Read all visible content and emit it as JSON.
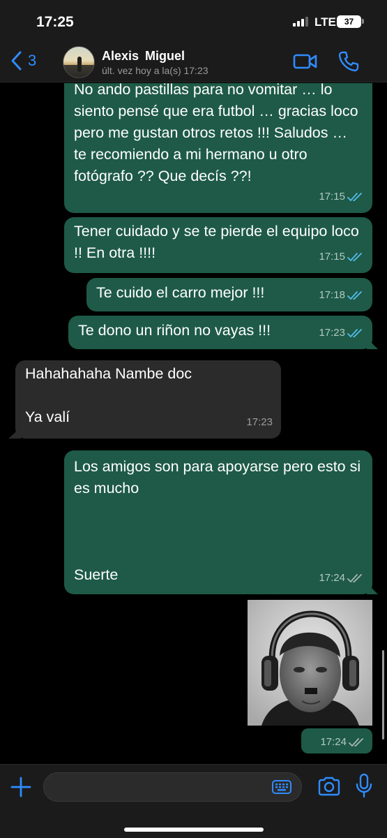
{
  "status_bar": {
    "time": "17:25",
    "network": "LTE",
    "battery": "37"
  },
  "header": {
    "back_count": "3",
    "contact_name": "Alexis  Miguel",
    "last_seen": "últ. vez hoy a la(s) 17:23"
  },
  "messages": [
    {
      "direction": "outgoing",
      "text": "No ando pastillas para no vomitar … lo siento pensé que era futbol … gracias loco pero me gustan otros retos !!! Saludos … te recomiendo a mi hermano u otro fotógrafo ?? Que decís ??!",
      "time": "17:15",
      "status": "read"
    },
    {
      "direction": "outgoing",
      "text": "Tener cuidado y se te pierde el equipo loco !! En otra !!!!",
      "time": "17:15",
      "status": "read"
    },
    {
      "direction": "outgoing",
      "text": "Te cuido el carro mejor !!!",
      "time": "17:18",
      "status": "read"
    },
    {
      "direction": "outgoing",
      "text": "Te dono un riñon no vayas !!!",
      "time": "17:23",
      "status": "read"
    },
    {
      "direction": "incoming",
      "text": "Hahahahaha Nambe doc\n\nYa valí",
      "time": "17:23"
    },
    {
      "direction": "outgoing",
      "text": "Los amigos son para apoyarse pero esto si es mucho\n\n\n\nSuerte",
      "time": "17:24",
      "status": "delivered"
    },
    {
      "direction": "outgoing",
      "type": "image",
      "time": "17:24",
      "status": "delivered"
    }
  ],
  "colors": {
    "outgoing_bubble": "#1e5a47",
    "incoming_bubble": "#2b2b2b",
    "accent": "#2f8cff",
    "read_ticks": "#53bdeb",
    "delivered_ticks": "#a8b8b2"
  },
  "icons": {
    "back": "chevron-left-icon",
    "video": "video-camera-icon",
    "call": "phone-icon",
    "plus": "plus-icon",
    "sticker": "keyboard-icon",
    "camera": "camera-icon",
    "mic": "microphone-icon"
  },
  "input": {
    "value": ""
  }
}
